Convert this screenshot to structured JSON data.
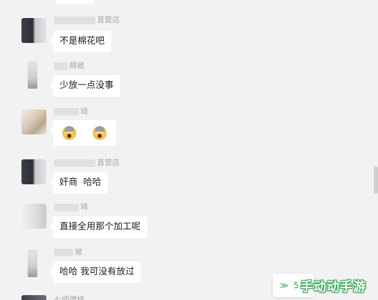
{
  "messages": [
    {
      "name_suffix": "直营店",
      "text": "不是棉花吧",
      "avatar": "avatar-dark"
    },
    {
      "name_suffix": "棉被",
      "text": "少放一点没事",
      "avatar": "avatar-light"
    },
    {
      "name_suffix": "琦",
      "text": "",
      "emojis": [
        "scream-emoji",
        "scream-emoji"
      ],
      "avatar": "avatar-tan"
    },
    {
      "name_suffix": "直营店",
      "text": "奸商  哈哈",
      "avatar": "avatar-dark"
    },
    {
      "name_suffix": "琦",
      "text": "直接全用那个加工呢",
      "avatar": "avatar-gray"
    },
    {
      "name_suffix": "被",
      "text": "哈哈 我可没有放过",
      "avatar": "avatar-light"
    }
  ],
  "bottom_name": "七师傅棉",
  "new_message_button": {
    "chevron": "≫",
    "count": "5"
  },
  "watermark": "手动动手游",
  "icons": {
    "chevron": "chevron-double-down-icon"
  },
  "colors": {
    "background": "#f2f2f2",
    "bubble": "#ffffff",
    "accent_green": "#2aa64a",
    "name_gray": "#a8a8a8"
  }
}
